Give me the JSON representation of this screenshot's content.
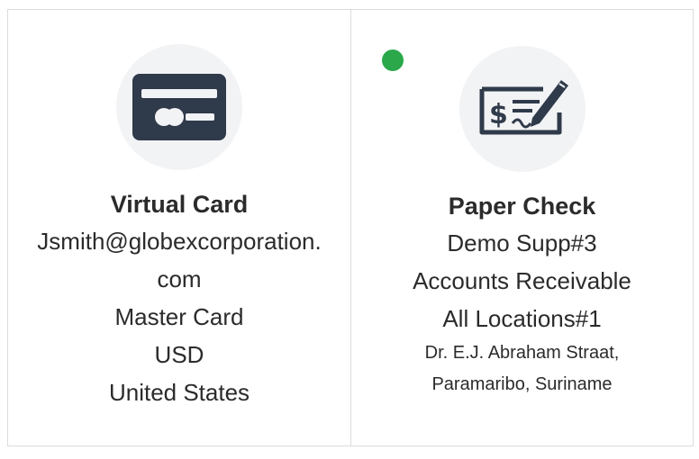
{
  "cards": [
    {
      "title": "Virtual Card",
      "icon": "credit-card-icon",
      "lines": [
        "Jsmith@globexcorporation.com",
        "Master Card",
        "USD",
        "United States"
      ]
    },
    {
      "title": "Paper Check",
      "icon": "check-icon",
      "selected": true,
      "lines": [
        "Demo Supp#3",
        "Accounts Receivable",
        "All Locations#1"
      ],
      "address_lines": [
        "Dr. E.J. Abraham Straat,",
        "Paramaribo, Suriname"
      ]
    }
  ],
  "colors": {
    "selected_dot": "#2aa84a",
    "icon_dark": "#2f3a4a",
    "icon_bg": "#f2f3f5",
    "border": "#dcdcdc"
  }
}
